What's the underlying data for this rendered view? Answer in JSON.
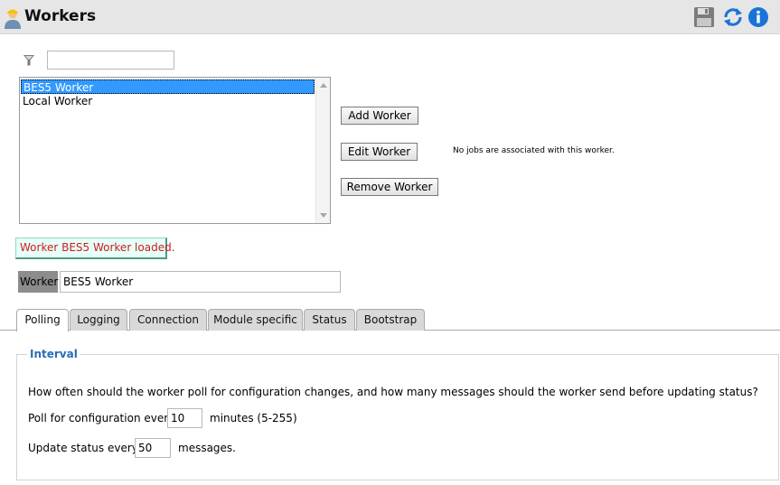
{
  "header": {
    "title": "Workers",
    "app_icon": "worker-person-icon",
    "actions": [
      {
        "id": "save",
        "icon": "floppy-disk-icon"
      },
      {
        "id": "refresh",
        "icon": "refresh-icon"
      },
      {
        "id": "info",
        "icon": "info-icon"
      }
    ],
    "accent_color": "#1a73d9"
  },
  "filter": {
    "icon": "filter-funnel-icon",
    "value": "",
    "placeholder": ""
  },
  "workers": {
    "items": [
      "BES5 Worker",
      "Local Worker"
    ],
    "selected_index": 0
  },
  "buttons": {
    "add": "Add Worker",
    "edit": "Edit Worker",
    "remove": "Remove Worker"
  },
  "jobs_note": "No jobs are associated with this worker.",
  "status_message": "Worker BES5 Worker loaded.",
  "worker_field": {
    "label": "Worker",
    "value": "BES5 Worker"
  },
  "tabs": [
    {
      "label": "Polling",
      "active": true
    },
    {
      "label": "Logging",
      "active": false
    },
    {
      "label": "Connection",
      "active": false
    },
    {
      "label": "Module specific",
      "active": false
    },
    {
      "label": "Status",
      "active": false
    },
    {
      "label": "Bootstrap",
      "active": false
    }
  ],
  "interval": {
    "legend": "Interval",
    "question": "How often should the worker poll for configuration changes, and how many messages should the worker send before updating status?",
    "poll_label": "Poll for configuration every",
    "poll_value": "10",
    "poll_unit": "minutes (5-255)",
    "update_label": "Update status every",
    "update_value": "50",
    "update_unit": "messages."
  }
}
